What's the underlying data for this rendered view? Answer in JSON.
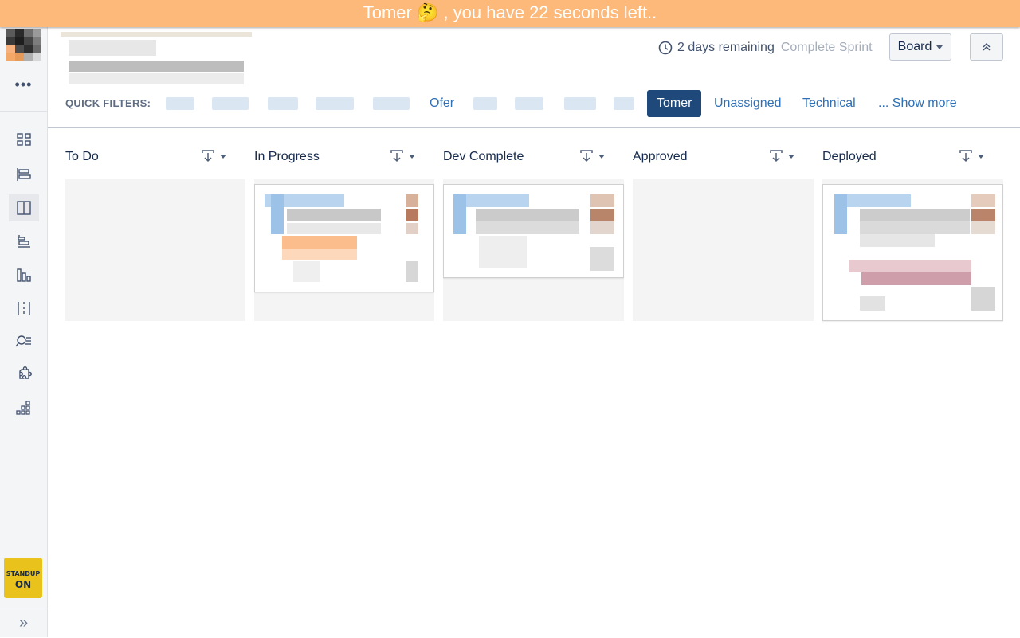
{
  "banner": {
    "text": "Tomer 🤔 , you have 22 seconds left.."
  },
  "sidebar": {
    "more_label": "•••",
    "nav_icons": [
      "backlog-icon",
      "roadmap-icon",
      "board-icon",
      "releases-icon",
      "reports-icon",
      "components-icon",
      "issues-icon",
      "addons-icon",
      "apps-icon"
    ],
    "standup": {
      "line1": "STANDUP",
      "line2": "ON"
    },
    "expand_label": "»"
  },
  "header": {
    "days_remaining": "2 days remaining",
    "complete_sprint": "Complete Sprint",
    "board_button": "Board"
  },
  "quick_filters": {
    "label": "QUICK FILTERS:",
    "items": [
      {
        "label": "Ofer"
      },
      {
        "label": "Tomer",
        "active": true
      },
      {
        "label": "Unassigned"
      },
      {
        "label": "Technical"
      },
      {
        "label": "... Show more"
      }
    ]
  },
  "columns": [
    {
      "name": "To Do",
      "cards": 0
    },
    {
      "name": "In Progress",
      "cards": 1
    },
    {
      "name": "Dev Complete",
      "cards": 1
    },
    {
      "name": "Approved",
      "cards": 0
    },
    {
      "name": "Deployed",
      "cards": 1
    }
  ],
  "colors": {
    "banner": "#fdb97a",
    "active_filter": "#20497b",
    "link": "#2e6fb5",
    "standup": "#e9c31c"
  }
}
